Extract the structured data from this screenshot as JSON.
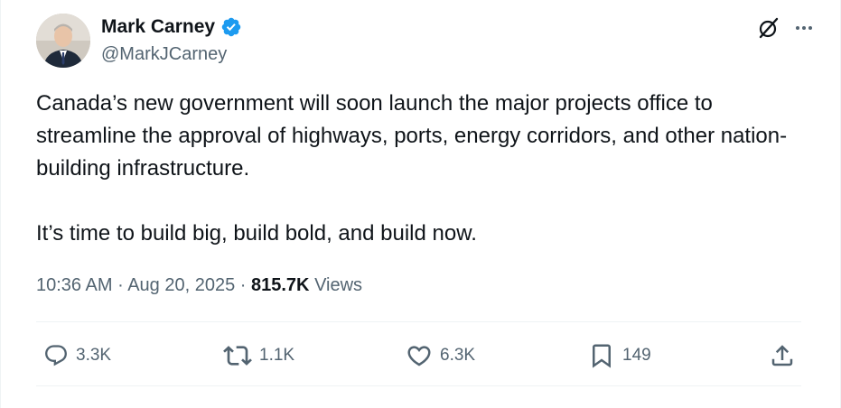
{
  "author": {
    "display_name": "Mark Carney",
    "handle": "@MarkJCarney",
    "verified": true,
    "avatar_icon": "avatar-photo"
  },
  "tweet": {
    "paragraphs": [
      "Canada’s new government will soon launch the major projects office to streamline the approval of highways, ports, energy corridors, and other nation-building infrastructure.",
      "It’s time to build big, build bold, and build now."
    ]
  },
  "meta": {
    "time": "10:36 AM",
    "separator": "·",
    "date": "Aug 20, 2025",
    "views_count": "815.7K",
    "views_label": "Views"
  },
  "actions": {
    "reply_count": "3.3K",
    "repost_count": "1.1K",
    "like_count": "6.3K",
    "bookmark_count": "149"
  },
  "colors": {
    "text": "#0f1419",
    "secondary": "#536471",
    "verified": "#1d9bf0",
    "divider": "#eff3f4"
  }
}
